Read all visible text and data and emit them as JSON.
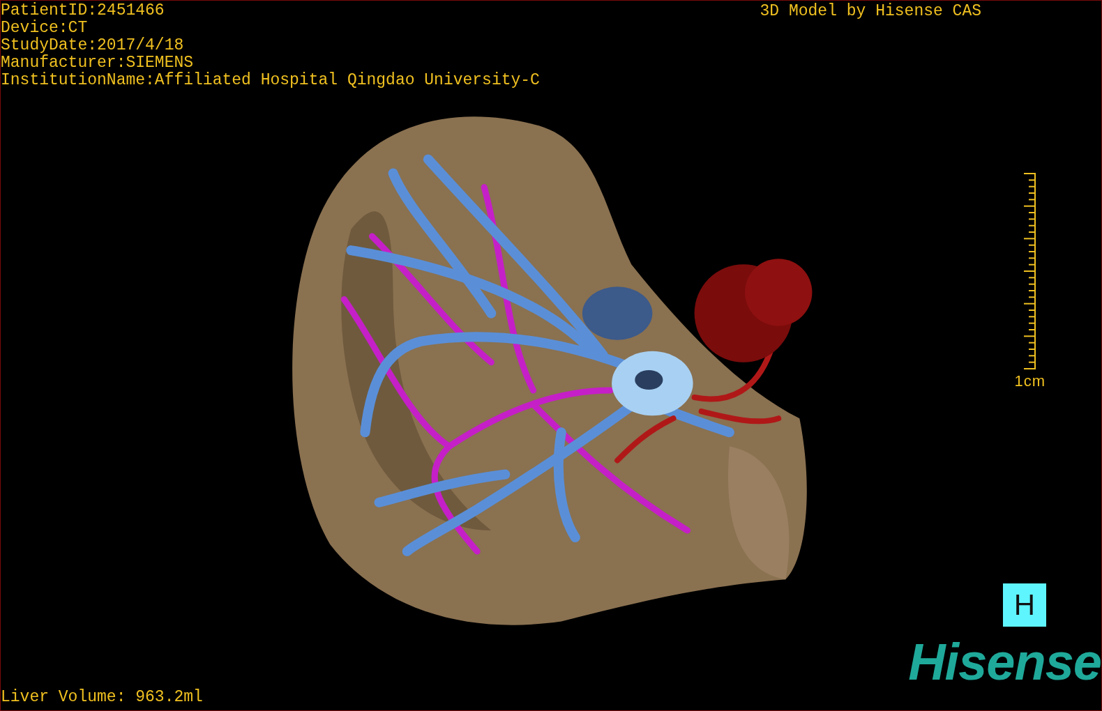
{
  "patient_info": [
    "PatientID:2451466",
    "Device:CT",
    "StudyDate:2017/4/18",
    "Manufacturer:SIEMENS",
    "InstitutionName:Affiliated Hospital Qingdao University-C"
  ],
  "title": "3D Model by Hisense CAS",
  "scale": {
    "label": "1cm"
  },
  "orientation_button": "H",
  "logo": "Hisense",
  "liver_volume": "Liver Volume: 963.2ml"
}
